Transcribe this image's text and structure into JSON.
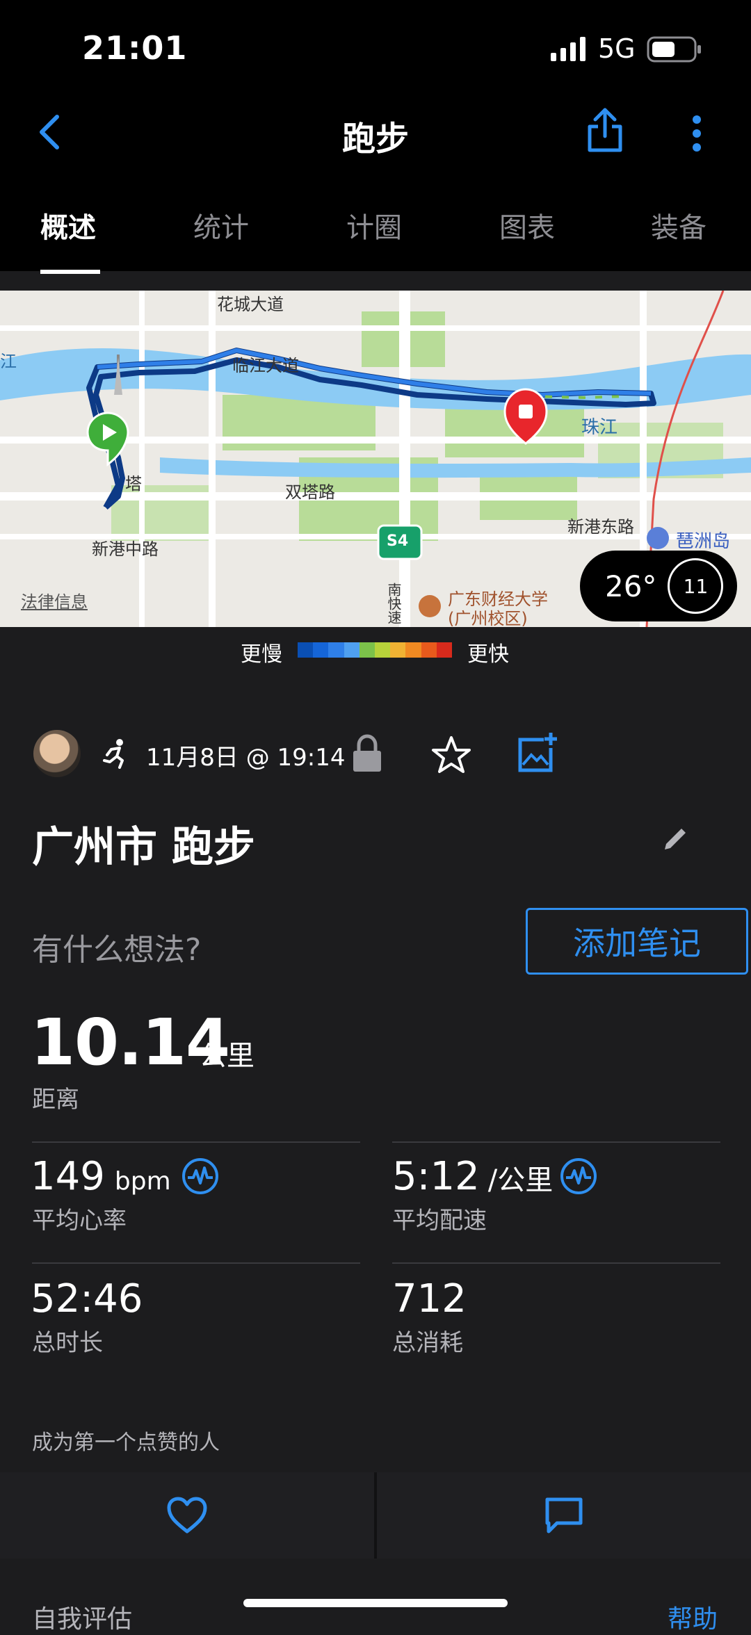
{
  "status": {
    "time": "21:01",
    "network": "5G"
  },
  "header": {
    "title": "跑步"
  },
  "tabs": [
    "概述",
    "统计",
    "计圈",
    "图表",
    "装备"
  ],
  "map": {
    "labels": {
      "huacheng": "花城大道",
      "linjiang": "临江大道",
      "jiang": "江",
      "zhujiang": "珠江",
      "ta": "塔",
      "shuangta": "双塔路",
      "xingangzhong": "新港中路",
      "xingangdong": "新港东路",
      "pazhou": "琶洲岛",
      "legal": "法律信息",
      "university": "广东财经大学",
      "campus": "(广州校区)",
      "highway": "S4",
      "expressway": "南快速"
    },
    "weather": {
      "temp": "26°",
      "number": "11"
    }
  },
  "legend": {
    "slow": "更慢",
    "fast": "更快",
    "colors": [
      "#0a4fb4",
      "#1565d8",
      "#2f7fe8",
      "#4fa0f0",
      "#7cc24a",
      "#b7d23a",
      "#f0b233",
      "#f08a22",
      "#e85a1c",
      "#d82a1c"
    ]
  },
  "activity": {
    "date": "11月8日 @ 19:14",
    "title": "广州市 跑步",
    "thoughts_placeholder": "有什么想法?",
    "add_note": "添加笔记"
  },
  "stats": {
    "distance": {
      "value": "10.14",
      "unit": "公里",
      "label": "距离"
    },
    "heart_rate": {
      "value": "149",
      "unit": "bpm",
      "label": "平均心率"
    },
    "pace": {
      "value": "5:12",
      "unit": "/公里",
      "label": "平均配速"
    },
    "duration": {
      "value": "52:46",
      "label": "总时长"
    },
    "calories": {
      "value": "712",
      "label": "总消耗"
    }
  },
  "social": {
    "likes_text": "成为第一个点赞的人"
  },
  "footer": {
    "self_eval": "自我评估",
    "help": "帮助"
  },
  "colors": {
    "accent": "#2f8ff0",
    "background": "#1c1c1e"
  }
}
